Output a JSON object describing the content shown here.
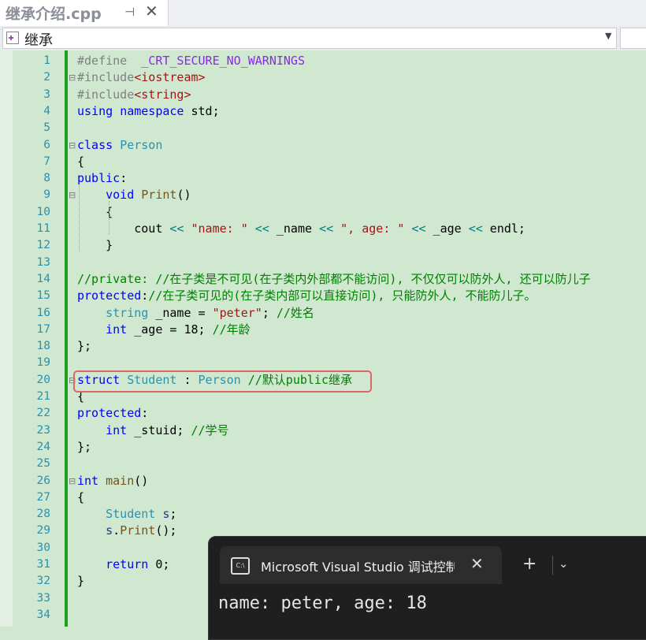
{
  "tab": {
    "title": "继承介绍.cpp",
    "pin_icon": "pin-icon",
    "close_icon": "close-icon"
  },
  "navbar": {
    "scope": "继承"
  },
  "editor": {
    "line_numbers": [
      "1",
      "2",
      "3",
      "4",
      "5",
      "6",
      "7",
      "8",
      "9",
      "10",
      "11",
      "12",
      "13",
      "14",
      "15",
      "16",
      "17",
      "18",
      "19",
      "20",
      "21",
      "22",
      "23",
      "24",
      "25",
      "26",
      "27",
      "28",
      "29",
      "30",
      "31",
      "32",
      "33",
      "34"
    ],
    "lines": [
      [
        {
          "t": "#define  ",
          "c": "pp"
        },
        {
          "t": "_CRT_SECURE_NO_WARNINGS",
          "c": "mac"
        }
      ],
      [
        {
          "t": "#include",
          "c": "pp"
        },
        {
          "t": "<iostream>",
          "c": "str"
        }
      ],
      [
        {
          "t": "#include",
          "c": "pp"
        },
        {
          "t": "<string>",
          "c": "str"
        }
      ],
      [
        {
          "t": "using",
          "c": "kw"
        },
        {
          "t": " "
        },
        {
          "t": "namespace",
          "c": "kw"
        },
        {
          "t": " std;"
        }
      ],
      [],
      [
        {
          "t": "class",
          "c": "kw"
        },
        {
          "t": " "
        },
        {
          "t": "Person",
          "c": "ty"
        }
      ],
      [
        {
          "t": "{"
        }
      ],
      [
        {
          "t": "public",
          "c": "kw"
        },
        {
          "t": ":"
        }
      ],
      [
        {
          "t": "    "
        },
        {
          "t": "void",
          "c": "kw"
        },
        {
          "t": " "
        },
        {
          "t": "Print",
          "c": "fn"
        },
        {
          "t": "()"
        }
      ],
      [
        {
          "t": "    {"
        }
      ],
      [
        {
          "t": "        cout "
        },
        {
          "t": "<<",
          "c": "op"
        },
        {
          "t": " "
        },
        {
          "t": "\"name: \"",
          "c": "str"
        },
        {
          "t": " "
        },
        {
          "t": "<<",
          "c": "op"
        },
        {
          "t": " _name "
        },
        {
          "t": "<<",
          "c": "op"
        },
        {
          "t": " "
        },
        {
          "t": "\", age: \"",
          "c": "str"
        },
        {
          "t": " "
        },
        {
          "t": "<<",
          "c": "op"
        },
        {
          "t": " _age "
        },
        {
          "t": "<<",
          "c": "op"
        },
        {
          "t": " endl;"
        }
      ],
      [
        {
          "t": "    }"
        }
      ],
      [],
      [
        {
          "t": "//private: //在子类是不可见(在子类内外部都不能访问), 不仅仅可以防外人, 还可以防儿子",
          "c": "cm"
        }
      ],
      [
        {
          "t": "protected",
          "c": "kw"
        },
        {
          "t": ":"
        },
        {
          "t": "//在子类可见的(在子类内部可以直接访问), 只能防外人, 不能防儿子。",
          "c": "cm"
        }
      ],
      [
        {
          "t": "    "
        },
        {
          "t": "string",
          "c": "ty"
        },
        {
          "t": " _name = "
        },
        {
          "t": "\"peter\"",
          "c": "str"
        },
        {
          "t": "; "
        },
        {
          "t": "//姓名",
          "c": "cm"
        }
      ],
      [
        {
          "t": "    "
        },
        {
          "t": "int",
          "c": "kw"
        },
        {
          "t": " _age = 18; "
        },
        {
          "t": "//年龄",
          "c": "cm"
        }
      ],
      [
        {
          "t": "};"
        }
      ],
      [],
      [
        {
          "t": "struct",
          "c": "kw"
        },
        {
          "t": " "
        },
        {
          "t": "Student",
          "c": "ty"
        },
        {
          "t": " : "
        },
        {
          "t": "Person",
          "c": "ty"
        },
        {
          "t": " "
        },
        {
          "t": "//默认public继承",
          "c": "cm"
        }
      ],
      [
        {
          "t": "{"
        }
      ],
      [
        {
          "t": "protected",
          "c": "kw"
        },
        {
          "t": ":"
        }
      ],
      [
        {
          "t": "    "
        },
        {
          "t": "int",
          "c": "kw"
        },
        {
          "t": " _stuid; "
        },
        {
          "t": "//学号",
          "c": "cm"
        }
      ],
      [
        {
          "t": "};"
        }
      ],
      [],
      [
        {
          "t": "int",
          "c": "kw"
        },
        {
          "t": " "
        },
        {
          "t": "main",
          "c": "fn"
        },
        {
          "t": "()"
        }
      ],
      [
        {
          "t": "{"
        }
      ],
      [
        {
          "t": "    "
        },
        {
          "t": "Student",
          "c": "ty"
        },
        {
          "t": " "
        },
        {
          "t": "s",
          "c": "var"
        },
        {
          "t": ";"
        }
      ],
      [
        {
          "t": "    "
        },
        {
          "t": "s",
          "c": "var"
        },
        {
          "t": "."
        },
        {
          "t": "Print",
          "c": "fn"
        },
        {
          "t": "();"
        }
      ],
      [],
      [
        {
          "t": "    "
        },
        {
          "t": "return",
          "c": "kw"
        },
        {
          "t": " 0;"
        }
      ],
      [
        {
          "t": "}"
        }
      ],
      [],
      []
    ],
    "fold_lines": [
      2,
      6,
      9,
      20,
      26
    ]
  },
  "terminal": {
    "tab_title": "Microsoft Visual Studio 调试控制台",
    "terminal_icon": "terminal-icon",
    "close_icon": "close-icon",
    "new_tab_icon": "plus-icon",
    "dropdown_icon": "chevron-down-icon",
    "output": "name: peter, age: 18"
  }
}
